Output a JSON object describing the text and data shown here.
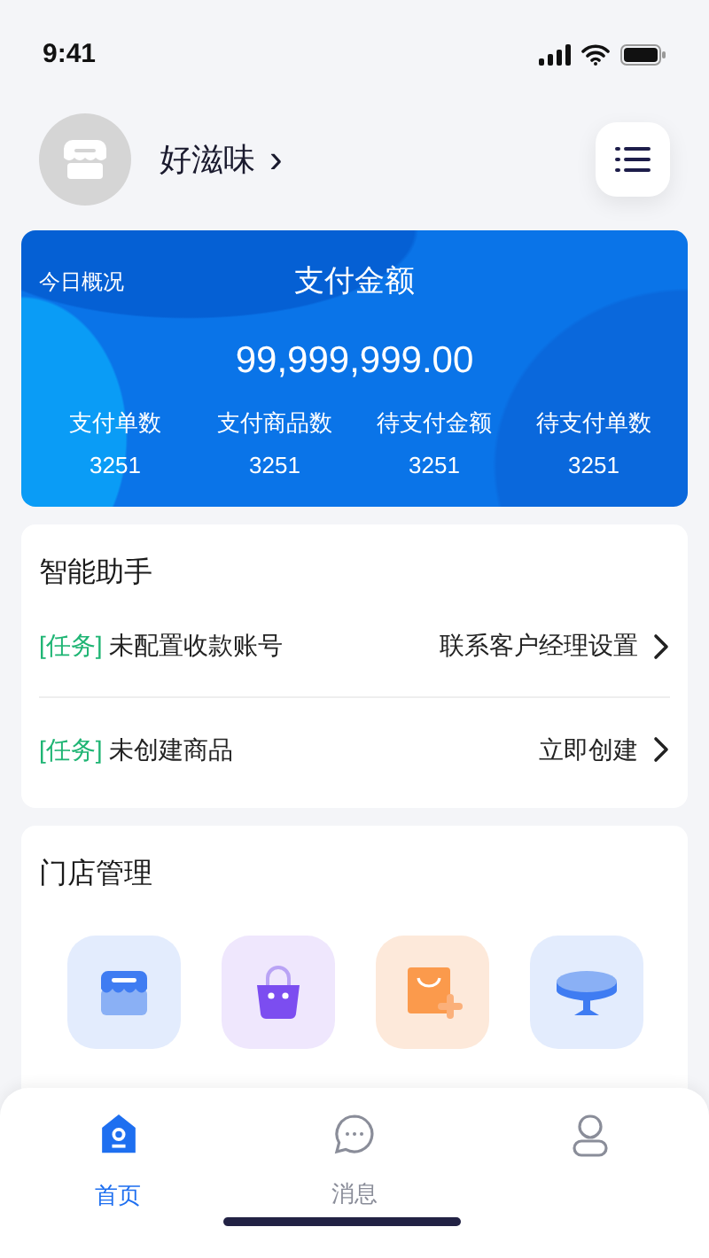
{
  "status_bar": {
    "time": "9:41"
  },
  "header": {
    "store_name": "好滋味",
    "chevron": "›"
  },
  "overview": {
    "label": "今日概况",
    "title": "支付金额",
    "amount": "99,999,999.00",
    "stats": [
      {
        "label": "支付单数",
        "value": "3251"
      },
      {
        "label": "支付商品数",
        "value": "3251"
      },
      {
        "label": "待支付金额",
        "value": "3251"
      },
      {
        "label": "待支付单数",
        "value": "3251"
      }
    ]
  },
  "assistant": {
    "title": "智能助手",
    "tasks": [
      {
        "tag": "[任务]",
        "text": "未配置收款账号",
        "action": "联系客户经理设置"
      },
      {
        "tag": "[任务]",
        "text": "未创建商品",
        "action": "立即创建"
      }
    ]
  },
  "store_management": {
    "title": "门店管理",
    "tiles": [
      {
        "kind": "store"
      },
      {
        "kind": "bag"
      },
      {
        "kind": "add-product"
      },
      {
        "kind": "table"
      }
    ]
  },
  "tab_bar": [
    {
      "kind": "home",
      "label": "首页",
      "selected": true
    },
    {
      "kind": "message",
      "label": "消息",
      "selected": false
    },
    {
      "kind": "profile",
      "selected": false
    }
  ]
}
